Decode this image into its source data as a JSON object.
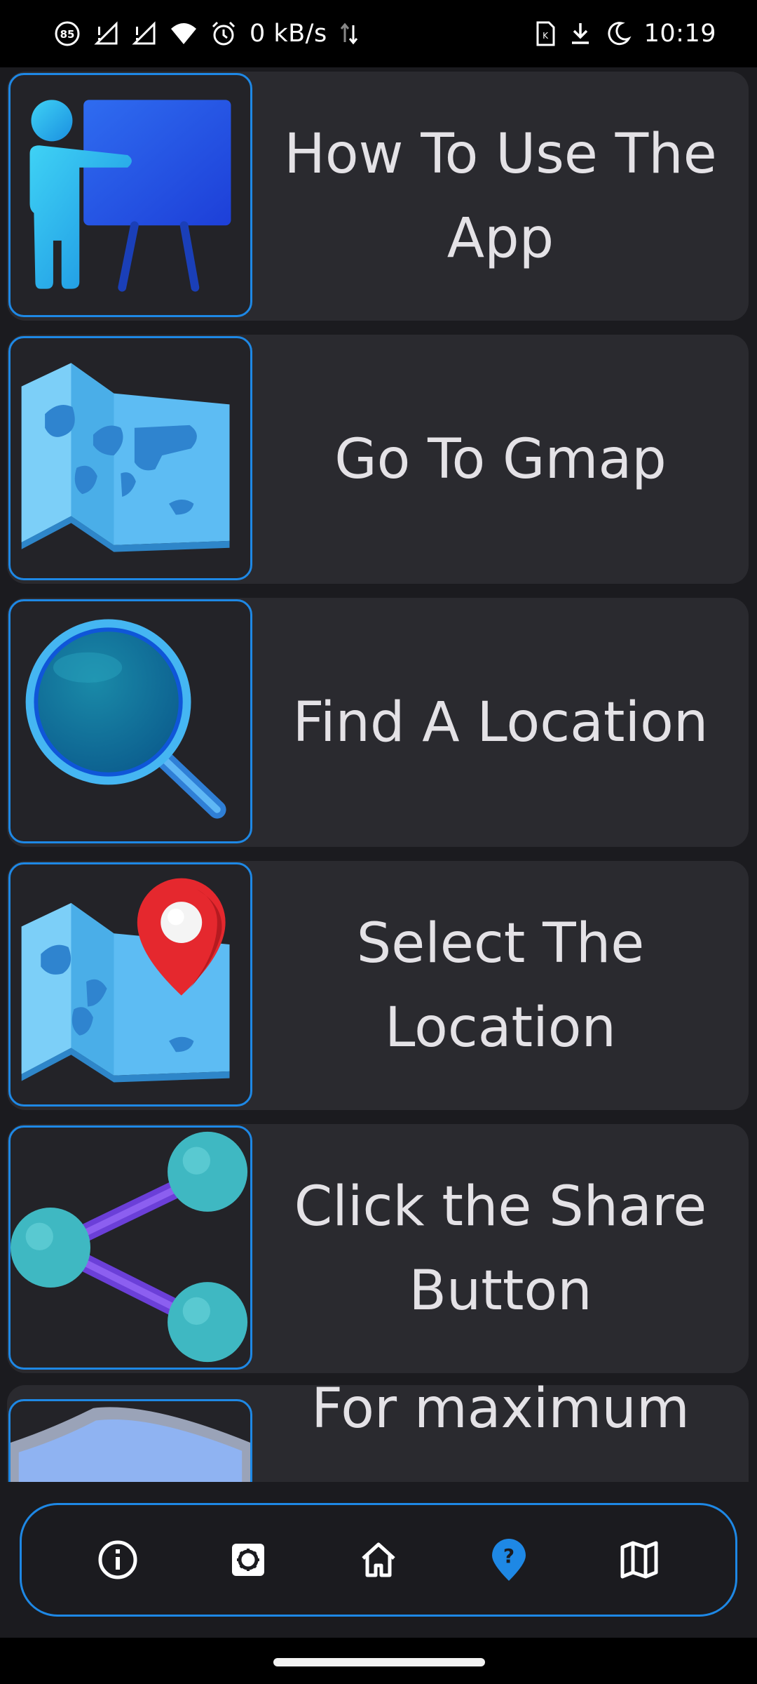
{
  "status_bar": {
    "time": "10:19",
    "network_speed": "0 kB/s",
    "badge": "85",
    "icons_left": [
      "notification-85-icon",
      "signal-no-sim-1-icon",
      "signal-no-sim-2-icon",
      "wifi-icon",
      "alarm-icon",
      "data-arrows-icon"
    ],
    "icons_right": [
      "sim-card-icon",
      "download-icon",
      "do-not-disturb-moon-icon"
    ]
  },
  "items": [
    {
      "label": "How To Use The App",
      "icon": "presentation-icon"
    },
    {
      "label": "Go To Gmap",
      "icon": "folded-map-icon"
    },
    {
      "label": "Find A Location",
      "icon": "magnifier-icon"
    },
    {
      "label": "Select The Location",
      "icon": "map-pin-icon"
    },
    {
      "label": "Click the Share Button",
      "icon": "share-icon"
    },
    {
      "label": "For maximum",
      "icon": "shield-icon"
    }
  ],
  "nav": {
    "items": [
      "info-icon",
      "settings-icon",
      "home-icon",
      "help-icon",
      "map-icon"
    ],
    "active": "help-icon",
    "active_color": "#1e88e5",
    "inactive_color": "#ffffff"
  },
  "colors": {
    "accent": "#1e88e5",
    "card_background": "#2a2a2f",
    "page_background": "#1b1b1f"
  }
}
